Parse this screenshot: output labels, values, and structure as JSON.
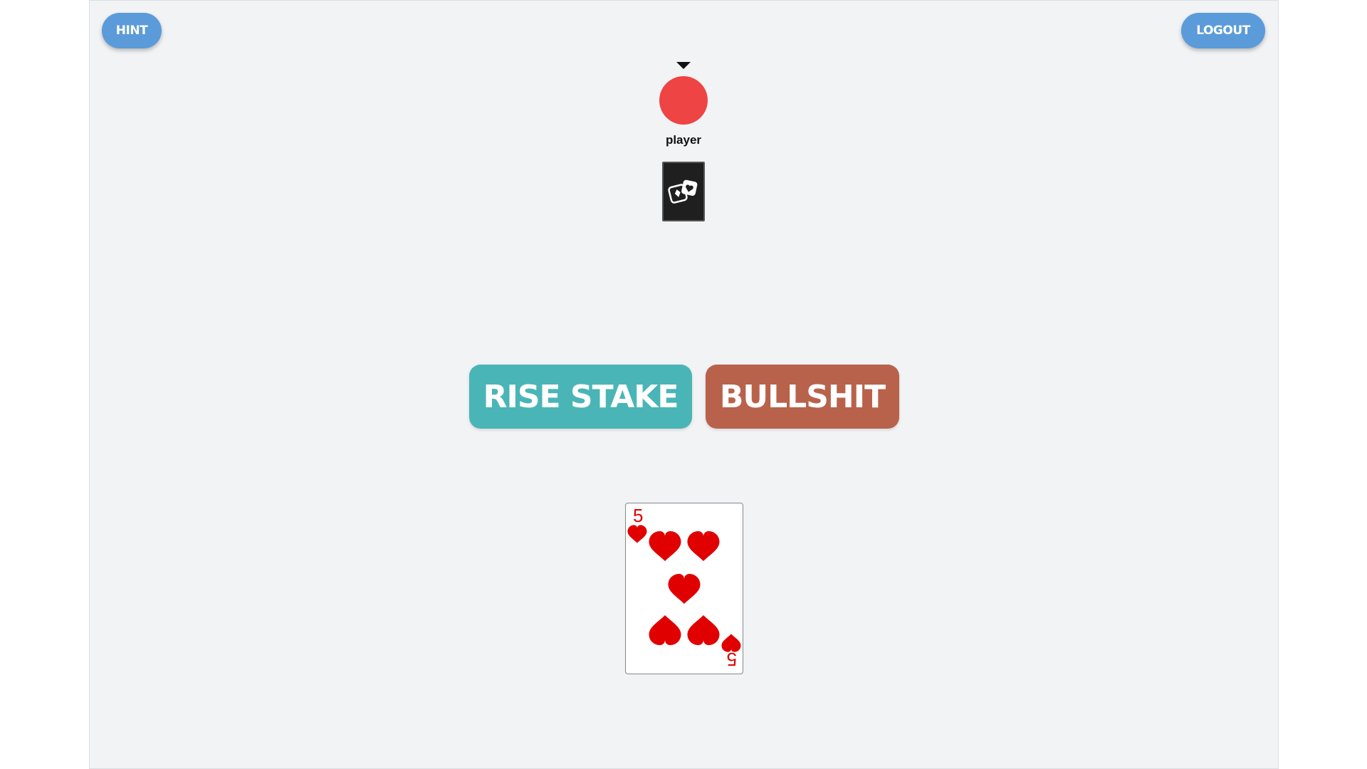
{
  "toolbar": {
    "hint_label": "HINT",
    "logout_label": "LOGOUT"
  },
  "opponent": {
    "name": "player",
    "is_current_turn": true,
    "avatar_color": "#ef4444",
    "cards_in_hand": 1,
    "card_back_icon": "dice-icon"
  },
  "actions": {
    "rise_stake_label": "RISE STAKE",
    "bullshit_label": "BULLSHIT"
  },
  "hand": {
    "cards": [
      {
        "rank": "5",
        "suit": "hearts",
        "suit_symbol": "♥",
        "color": "#e00000"
      }
    ]
  },
  "colors": {
    "background": "#f2f3f5",
    "hint_logout": "#5b9bd9",
    "rise_stake": "#4ab5b6",
    "bullshit": "#b9624b"
  }
}
